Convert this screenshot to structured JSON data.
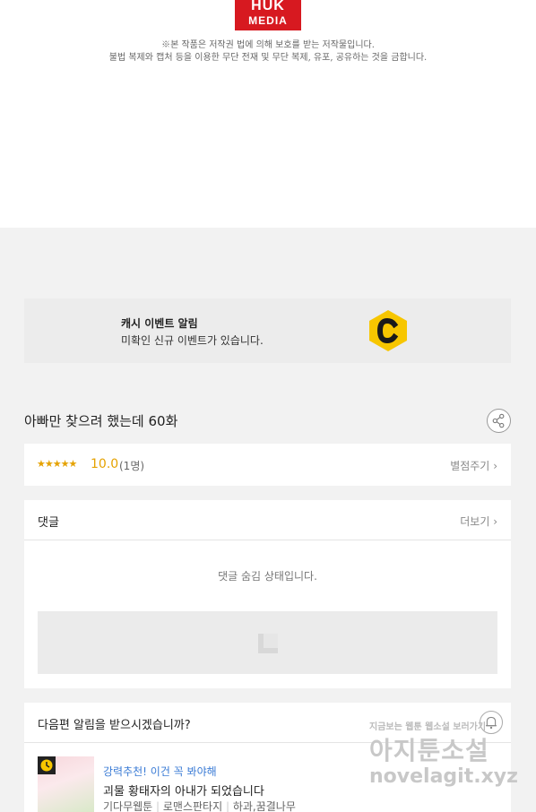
{
  "logo": {
    "line1": "HUK",
    "line2": "MEDIA"
  },
  "notice": {
    "line1": "※본 작품은 저작권 법에 의해 보호를 받는 저작물입니다.",
    "line2": "불법 복제와 캡처 등을 이용한 무단 전재 및 무단 복제, 유포, 공유하는 것을 금합니다."
  },
  "event": {
    "title": "캐시 이벤트 알림",
    "subtitle": "미확인 신규 이벤트가 있습니다.",
    "icon": "c-cash-icon",
    "icon_color": "#f7c600"
  },
  "episode": {
    "title": "아빠만 찾으려 했는데 60화",
    "share_icon": "share-icon"
  },
  "rating": {
    "stars": "★★★★★",
    "score": "10.0",
    "count": "(1명)",
    "give_label": "별점주기",
    "accent": "#e5a200"
  },
  "comments": {
    "title": "댓글",
    "more_label": "더보기",
    "hidden_text": "댓글 숨김 상태입니다."
  },
  "next_alert": {
    "question": "다음편 알림을 받으시겠습니까?",
    "recommend": "강력추천! 이건 꼭 봐야해",
    "work_title": "괴물 황태자의 아내가 되었습니다",
    "genre1": "기다무웹툰",
    "genre2": "로맨스판타지",
    "author": "하과,꿈결나무",
    "recommend_color": "#3a7bd5"
  },
  "watermark": {
    "line1": "지금보는 웹툰 웹소설 보러가기",
    "line2": "아지툰소설",
    "line3": "novelagit.xyz"
  }
}
